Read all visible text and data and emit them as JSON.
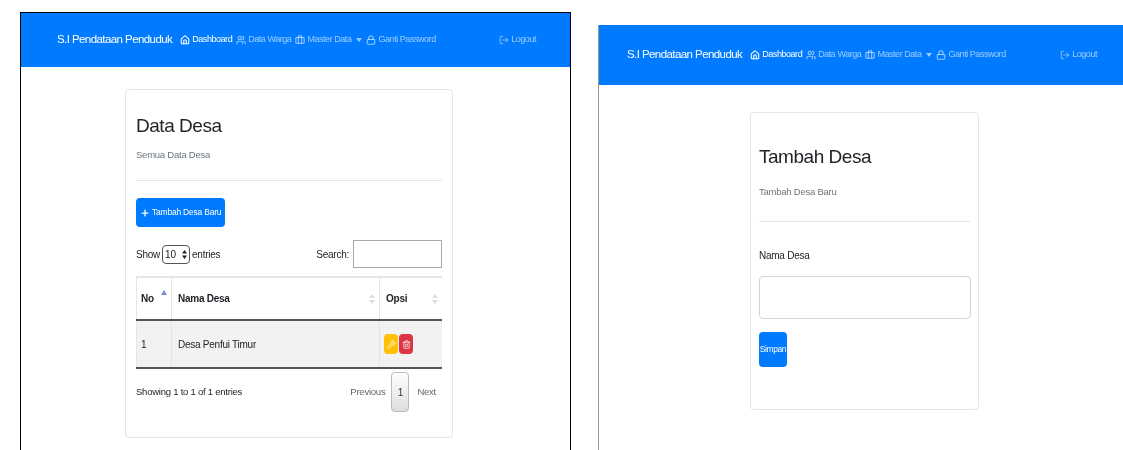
{
  "screens": [
    {
      "kind": "table_card",
      "navbar": {
        "brand": "S.I Pendataan Penduduk",
        "items": [
          {
            "label": "Dashboard",
            "selected": true,
            "dropdown": false
          },
          {
            "label": "Data Warga",
            "selected": false,
            "dropdown": false
          },
          {
            "label": "Master Data",
            "selected": false,
            "dropdown": true
          },
          {
            "label": "Ganti Password",
            "selected": false,
            "dropdown": false
          }
        ],
        "logout": "Logout"
      },
      "card": {
        "title": "Data Desa",
        "subtitle": "Semua Data Desa",
        "add_button": "Tambah Desa Baru",
        "show_label": "Show",
        "length_value": "10",
        "entries_label": "entries",
        "search_label": "Search:",
        "columns": [
          {
            "label": "No",
            "sorted": true
          },
          {
            "label": "Nama Desa",
            "sorted": false
          },
          {
            "label": "Opsi",
            "sorted": false
          }
        ],
        "rows": [
          {
            "no": "1",
            "name": "Desa Penfui Timur"
          }
        ],
        "info": "Showing 1 to 1 of 1 entries",
        "previous": "Previous",
        "pages": [
          {
            "label": "1",
            "selected": true
          }
        ],
        "next": "Next"
      }
    },
    {
      "kind": "form_card",
      "navbar": {
        "brand": "S.I Pendataan Penduduk",
        "items": [
          {
            "label": "Dashboard",
            "selected": true,
            "dropdown": false
          },
          {
            "label": "Data Warga",
            "selected": false,
            "dropdown": false
          },
          {
            "label": "Master Data",
            "selected": false,
            "dropdown": true
          },
          {
            "label": "Ganti Password",
            "selected": false,
            "dropdown": false
          }
        ],
        "logout": "Logout"
      },
      "card": {
        "title": "Tambah Desa",
        "subtitle": "Tambah Desa Baru",
        "field_label": "Nama Desa",
        "submit": "Simpan"
      }
    }
  ]
}
